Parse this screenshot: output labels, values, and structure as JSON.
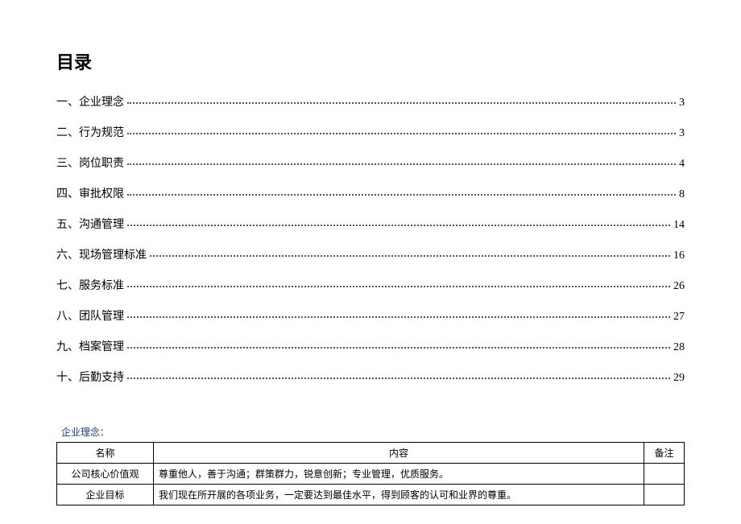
{
  "title": "目录",
  "toc": [
    {
      "label": "一、企业理念",
      "page": "3"
    },
    {
      "label": "二、行为规范",
      "page": "3"
    },
    {
      "label": "三、岗位职责",
      "page": "4"
    },
    {
      "label": "四、审批权限",
      "page": "8"
    },
    {
      "label": "五、沟通管理",
      "page": "14"
    },
    {
      "label": "六、现场管理标准",
      "page": "16"
    },
    {
      "label": "七、服务标准",
      "page": "26"
    },
    {
      "label": "八、团队管理",
      "page": "27"
    },
    {
      "label": "九、档案管理",
      "page": "28"
    },
    {
      "label": "十、后勤支持",
      "page": "29"
    }
  ],
  "section": {
    "heading": "企业理念：",
    "headers": {
      "name": "名称",
      "content": "内容",
      "note": "备注"
    },
    "rows": [
      {
        "name": "公司核心价值观",
        "content": "尊重他人，善于沟通；群策群力，锐意创新；专业管理，优质服务。",
        "note": ""
      },
      {
        "name": "企业目标",
        "content": "我们现在所开展的各项业务，一定要达到最佳水平，得到顾客的认可和业界的尊重。",
        "note": ""
      }
    ]
  }
}
